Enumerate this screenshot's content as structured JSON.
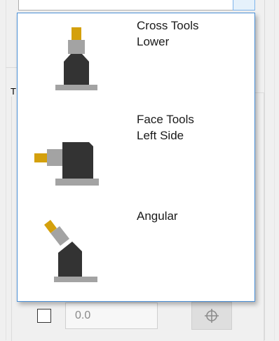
{
  "background": {
    "group_letter": "T",
    "value_field": "0.0",
    "crosshair_icon": "crosshair-icon"
  },
  "popup": {
    "options": [
      {
        "label": "Cross Tools\nLower",
        "icon": "cross-tool-lower-icon"
      },
      {
        "label": "Face Tools\nLeft Side",
        "icon": "face-tool-left-icon"
      },
      {
        "label": "Angular",
        "icon": "angular-tool-icon"
      }
    ]
  },
  "colors": {
    "tool_body": "#333333",
    "tool_gray": "#a3a3a3",
    "tool_yellow": "#d4a00c",
    "popup_border": "#4a8fd6"
  }
}
